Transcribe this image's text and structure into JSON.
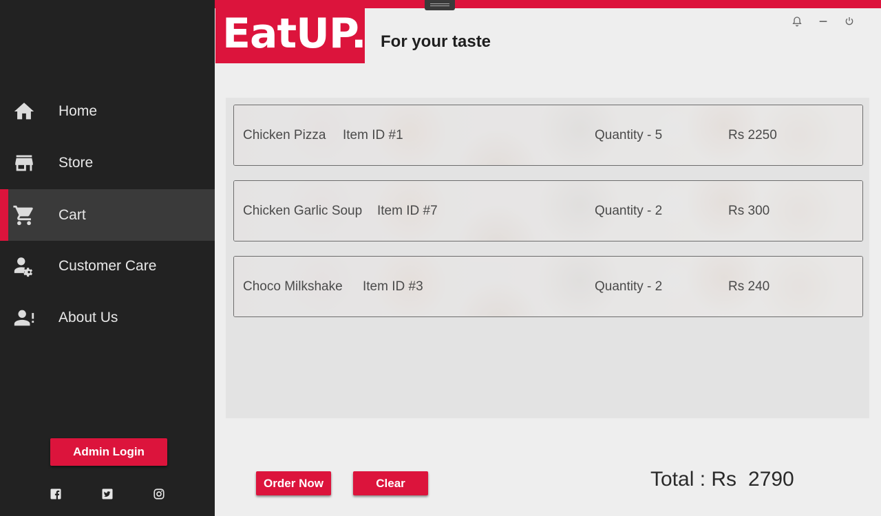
{
  "app": {
    "brand": "EatUP.",
    "tagline": "For your taste",
    "accent_color": "#dc143c"
  },
  "sidebar": {
    "items": [
      {
        "label": "Home",
        "icon": "home-icon"
      },
      {
        "label": "Store",
        "icon": "store-icon"
      },
      {
        "label": "Cart",
        "icon": "cart-icon",
        "active": true
      },
      {
        "label": "Customer Care",
        "icon": "user-gear-icon"
      },
      {
        "label": "About Us",
        "icon": "user-alert-icon"
      }
    ],
    "admin_login": "Admin Login",
    "social": [
      "facebook-icon",
      "twitter-icon",
      "instagram-icon"
    ]
  },
  "window_controls": [
    "bell-icon",
    "minimize-icon",
    "power-icon"
  ],
  "cart": {
    "items": [
      {
        "name": "Chicken Pizza",
        "item_id": "Item ID #1",
        "quantity": "Quantity - 5",
        "price": "Rs 2250"
      },
      {
        "name": "Chicken Garlic Soup",
        "item_id": "Item ID #7",
        "quantity": "Quantity - 2",
        "price": "Rs 300"
      },
      {
        "name": "Choco Milkshake",
        "item_id": "Item ID #3",
        "quantity": "Quantity - 2",
        "price": "Rs 240"
      }
    ]
  },
  "actions": {
    "order_now": "Order Now",
    "clear": "Clear"
  },
  "total": {
    "label": "Total : Rs",
    "value": "2790"
  }
}
